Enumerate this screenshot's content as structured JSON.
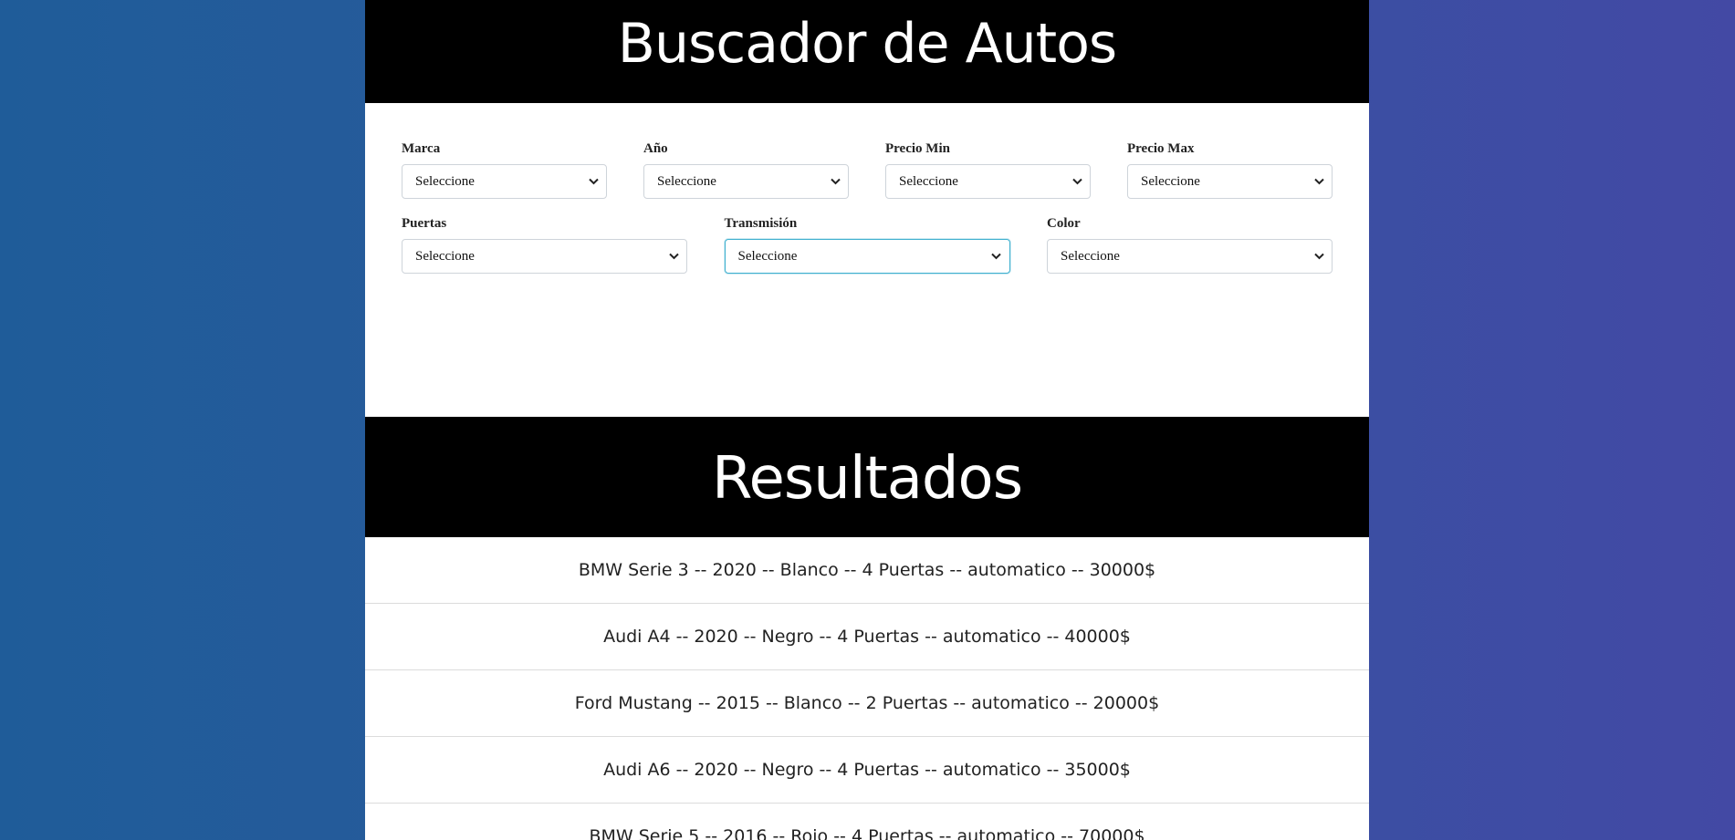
{
  "header": {
    "title": "Buscador de Autos"
  },
  "filters": {
    "row1": [
      {
        "label": "Marca",
        "value": "Seleccione"
      },
      {
        "label": "Año",
        "value": "Seleccione"
      },
      {
        "label": "Precio Min",
        "value": "Seleccione"
      },
      {
        "label": "Precio Max",
        "value": "Seleccione"
      }
    ],
    "row2": [
      {
        "label": "Puertas",
        "value": "Seleccione"
      },
      {
        "label": "Transmisión",
        "value": "Seleccione"
      },
      {
        "label": "Color",
        "value": "Seleccione"
      }
    ]
  },
  "results": {
    "title": "Resultados",
    "items": [
      "BMW Serie 3 -- 2020 -- Blanco -- 4 Puertas -- automatico -- 30000$",
      "Audi A4 -- 2020 -- Negro -- 4 Puertas -- automatico -- 40000$",
      "Ford Mustang -- 2015 -- Blanco -- 2 Puertas -- automatico -- 20000$",
      "Audi A6 -- 2020 -- Negro -- 4 Puertas -- automatico -- 35000$",
      "BMW Serie 5 -- 2016 -- Rojo -- 4 Puertas -- automatico -- 70000$"
    ]
  },
  "icons": {
    "select_arrow": "chevron-down-icon"
  },
  "colors": {
    "banner": "#000000",
    "focus_border": "#3fb0cf"
  }
}
